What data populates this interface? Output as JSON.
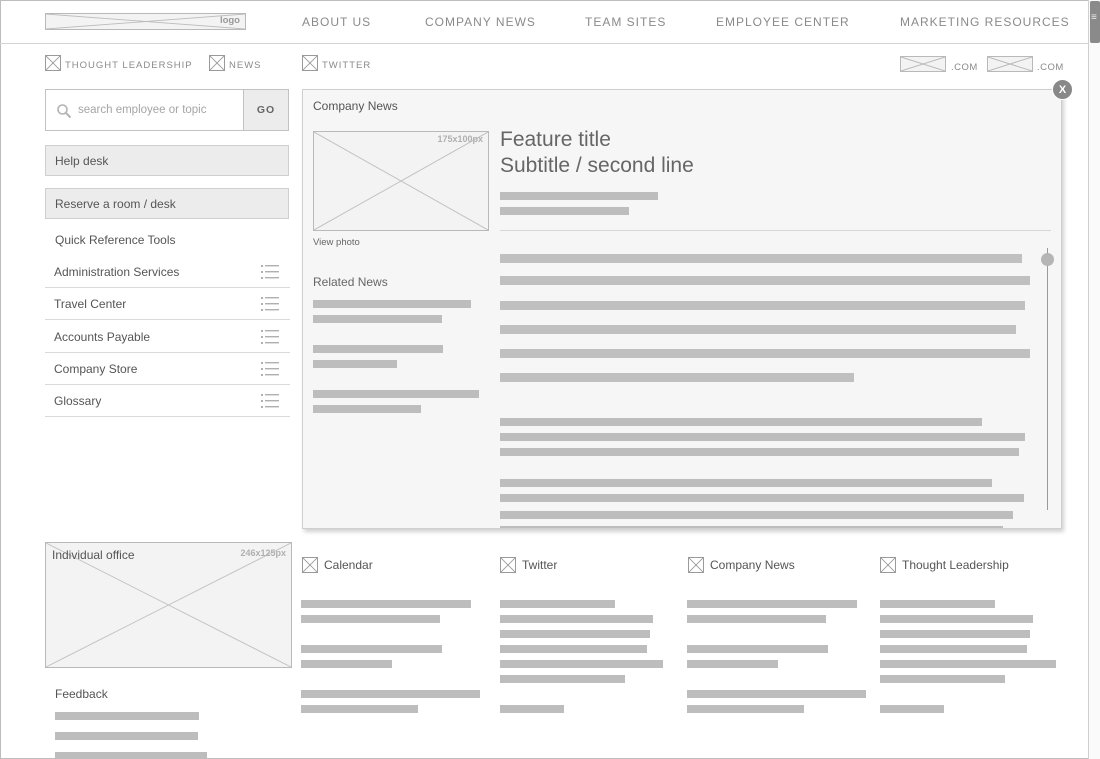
{
  "header": {
    "logo": "logo",
    "nav": [
      "ABOUT US",
      "COMPANY NEWS",
      "TEAM SITES",
      "EMPLOYEE CENTER",
      "MARKETING RESOURCES"
    ]
  },
  "subnav": {
    "links": [
      "THOUGHT LEADERSHIP",
      "NEWS",
      "TWITTER"
    ],
    "domains": [
      ".COM",
      ".COM"
    ]
  },
  "search": {
    "placeholder": "search employee or topic",
    "go_label": "GO"
  },
  "sidebar": {
    "buttons": [
      "Help desk",
      "Reserve a room / desk"
    ],
    "section_title": "Quick Reference Tools",
    "items": [
      "Administration Services",
      "Travel Center",
      "Accounts Payable",
      "Company Store",
      "Glossary"
    ]
  },
  "modal": {
    "close_label": "X",
    "title": "Company News",
    "image_size": "175x100px",
    "view_photo": "View photo",
    "related_title": "Related News",
    "feature_title": "Feature title",
    "feature_subtitle": "Subtitle / second line"
  },
  "office": {
    "title": "Individual office",
    "image_size": "246x125px"
  },
  "feedback": {
    "title": "Feedback"
  },
  "tiles": [
    "Calendar",
    "Twitter",
    "Company News",
    "Thought Leadership"
  ]
}
